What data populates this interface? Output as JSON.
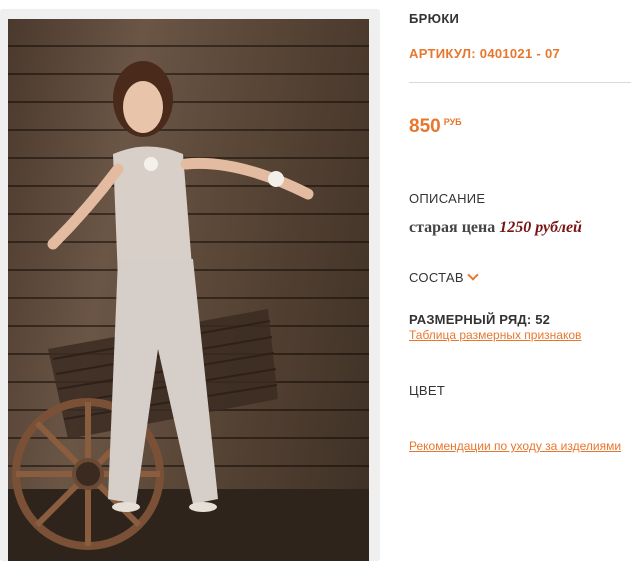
{
  "product": {
    "title": "БРЮКИ",
    "article": "АРТИКУЛ: 0401021 - 07",
    "price": "850",
    "currency": "РУБ",
    "description_label": "ОПИСАНИЕ",
    "description_text": "старая цена",
    "old_price": "1250 рублей",
    "composition_label": "СОСТАВ",
    "size_row": "РАЗМЕРНЫЙ РЯД: 52",
    "size_table_link": "Таблица размерных признаков",
    "color_label": "ЦВЕТ",
    "care_link": "Рекомендации по уходу за изделиями"
  },
  "colors": {
    "accent": "#e8772e",
    "old_price": "#7a1414",
    "text": "#333333"
  },
  "icons": {
    "composition_toggle": "chevron-down-icon"
  }
}
